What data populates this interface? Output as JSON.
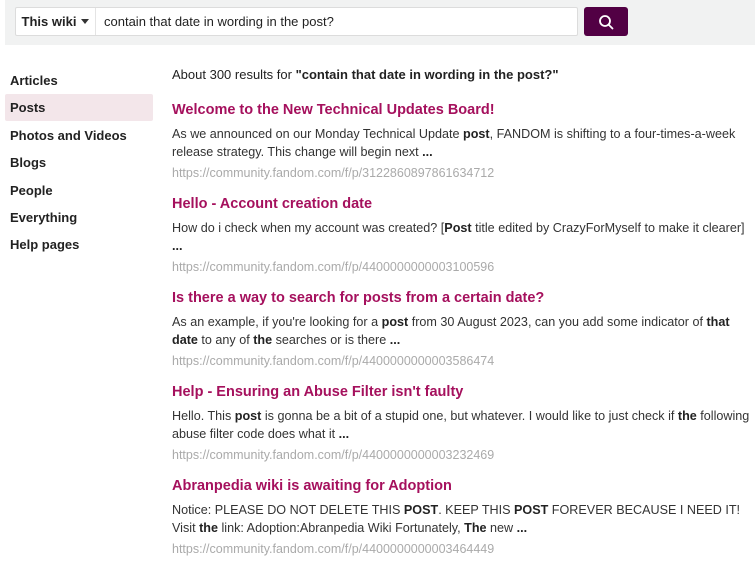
{
  "search": {
    "scope": "This wiki",
    "query": "contain that date in wording in the post?"
  },
  "sidebar": {
    "items": [
      {
        "label": "Articles"
      },
      {
        "label": "Posts",
        "active": true
      },
      {
        "label": "Photos and Videos"
      },
      {
        "label": "Blogs"
      },
      {
        "label": "People"
      },
      {
        "label": "Everything"
      },
      {
        "label": "Help pages"
      }
    ]
  },
  "summary": {
    "prefix": "About 300 results for ",
    "query": "\"contain that date in wording in the post?\""
  },
  "results": [
    {
      "title": "Welcome to the New Technical Updates Board!",
      "snippet": [
        [
          "As we announced on our Monday Technical Update ",
          0
        ],
        [
          "post",
          1
        ],
        [
          ", FANDOM is shifting to a four-times-a-week release strategy. This change will begin next ",
          0
        ],
        [
          "...",
          1
        ]
      ],
      "url": "https://community.fandom.com/f/p/3122860897861634712"
    },
    {
      "title": "Hello - Account creation date",
      "snippet": [
        [
          "How do i check when my account was created? [",
          0
        ],
        [
          "Post",
          1
        ],
        [
          " title edited by CrazyForMyself to make it clearer] ",
          0
        ],
        [
          "...",
          1
        ]
      ],
      "url": "https://community.fandom.com/f/p/4400000000003100596"
    },
    {
      "title": "Is there a way to search for posts from a certain date?",
      "snippet": [
        [
          "As an example, if you're looking for a ",
          0
        ],
        [
          "post",
          1
        ],
        [
          " from 30 August 2023, can you add some indicator of ",
          0
        ],
        [
          "that date",
          1
        ],
        [
          " to any of ",
          0
        ],
        [
          "the",
          1
        ],
        [
          " searches or is there ",
          0
        ],
        [
          "...",
          1
        ]
      ],
      "url": "https://community.fandom.com/f/p/4400000000003586474"
    },
    {
      "title": "Help - Ensuring an Abuse Filter isn't faulty",
      "snippet": [
        [
          "Hello. This ",
          0
        ],
        [
          "post",
          1
        ],
        [
          " is gonna be a bit of a stupid one, but whatever. I would like to just check if ",
          0
        ],
        [
          "the",
          1
        ],
        [
          " following abuse filter code does what it ",
          0
        ],
        [
          "...",
          1
        ]
      ],
      "url": "https://community.fandom.com/f/p/4400000000003232469"
    },
    {
      "title": "Abranpedia wiki is awaiting for Adoption",
      "snippet": [
        [
          "Notice: PLEASE DO NOT DELETE THIS ",
          0
        ],
        [
          "POST",
          1
        ],
        [
          ". KEEP THIS ",
          0
        ],
        [
          "POST",
          1
        ],
        [
          " FOREVER BECAUSE I NEED IT! Visit ",
          0
        ],
        [
          "the",
          1
        ],
        [
          " link: Adoption:Abranpedia Wiki Fortunately, ",
          0
        ],
        [
          "The",
          1
        ],
        [
          " new ",
          0
        ],
        [
          "...",
          1
        ]
      ],
      "url": "https://community.fandom.com/f/p/4400000000003464449"
    }
  ]
}
